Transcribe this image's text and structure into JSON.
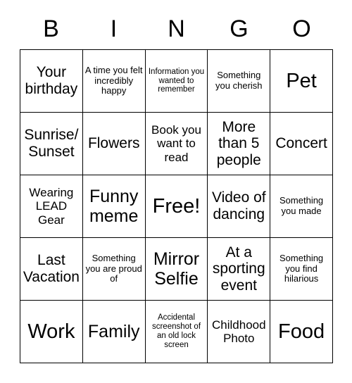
{
  "card": {
    "header_letters": [
      "B",
      "I",
      "N",
      "G",
      "O"
    ],
    "grid": {
      "rows": 5,
      "columns": 5,
      "cells": [
        {
          "text": "Your birthday",
          "size": "sz-md"
        },
        {
          "text": "A time you felt incredibly happy",
          "size": "sz-xs"
        },
        {
          "text": "Information you wanted to remember",
          "size": "sz-xxs"
        },
        {
          "text": "Something you cherish",
          "size": "sz-xs"
        },
        {
          "text": "Pet",
          "size": "sz-xl"
        },
        {
          "text": "Sunrise/ Sunset",
          "size": "sz-md"
        },
        {
          "text": "Flowers",
          "size": "sz-md"
        },
        {
          "text": "Book you want to read",
          "size": "sz-sm"
        },
        {
          "text": "More than 5 people",
          "size": "sz-md"
        },
        {
          "text": "Concert",
          "size": "sz-md"
        },
        {
          "text": "Wearing LEAD Gear",
          "size": "sz-sm"
        },
        {
          "text": "Funny meme",
          "size": "sz-lg"
        },
        {
          "text": "Free!",
          "size": "sz-xl"
        },
        {
          "text": "Video of dancing",
          "size": "sz-md"
        },
        {
          "text": "Something you made",
          "size": "sz-xs"
        },
        {
          "text": "Last Vacation",
          "size": "sz-md"
        },
        {
          "text": "Something you are proud of",
          "size": "sz-xs"
        },
        {
          "text": "Mirror Selfie",
          "size": "sz-lg"
        },
        {
          "text": "At a sporting event",
          "size": "sz-md"
        },
        {
          "text": "Something you find hilarious",
          "size": "sz-xs"
        },
        {
          "text": "Work",
          "size": "sz-xl"
        },
        {
          "text": "Family",
          "size": "sz-lg"
        },
        {
          "text": "Accidental screenshot of an old lock screen",
          "size": "sz-xxs"
        },
        {
          "text": "Childhood Photo",
          "size": "sz-sm"
        },
        {
          "text": "Food",
          "size": "sz-xl"
        }
      ]
    }
  }
}
